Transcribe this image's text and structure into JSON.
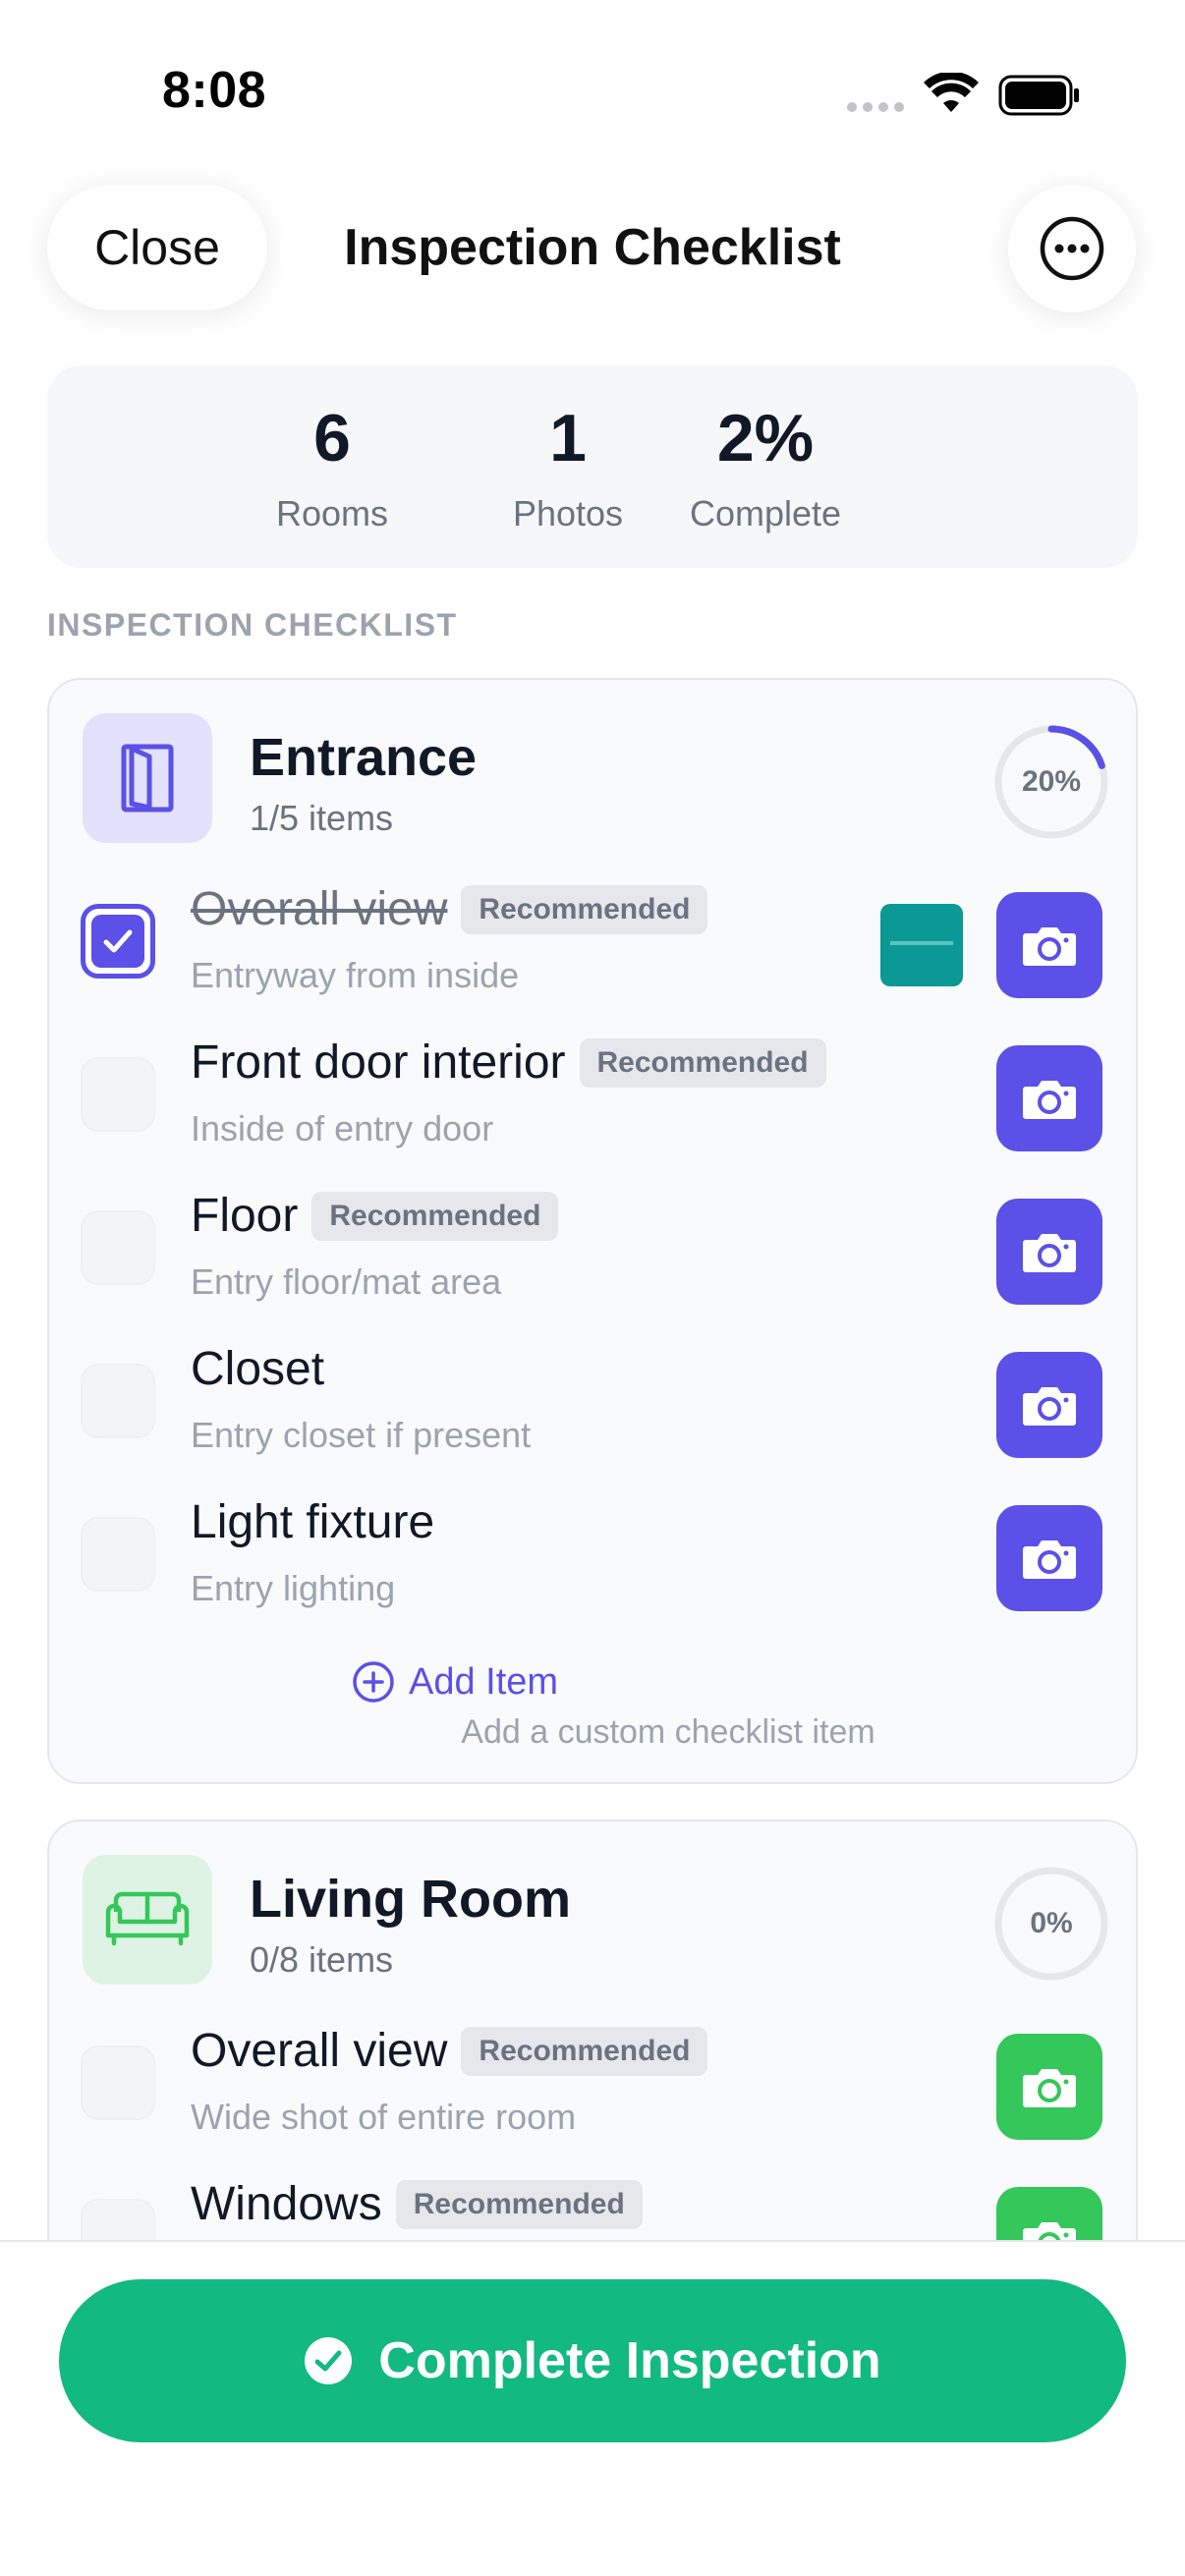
{
  "status_bar": {
    "time": "8:08"
  },
  "header": {
    "close_label": "Close",
    "title": "Inspection Checklist"
  },
  "stats": {
    "rooms": {
      "value": "6",
      "label": "Rooms"
    },
    "photos": {
      "value": "1",
      "label": "Photos"
    },
    "complete": {
      "value": "2%",
      "label": "Complete"
    }
  },
  "section_label": "INSPECTION CHECKLIST",
  "rooms": [
    {
      "name": "Entrance",
      "count": "1/5 items",
      "progress_text": "20%",
      "progress": 0.2,
      "icon": "door-icon",
      "items": [
        {
          "title": "Overall view",
          "badge": "Recommended",
          "subtitle": "Entryway from inside",
          "checked": true,
          "has_photo": true
        },
        {
          "title": "Front door interior",
          "badge": "Recommended",
          "subtitle": "Inside of entry door",
          "checked": false
        },
        {
          "title": "Floor",
          "badge": "Recommended",
          "subtitle": "Entry floor/mat area",
          "checked": false
        },
        {
          "title": "Closet",
          "subtitle": "Entry closet if present",
          "checked": false
        },
        {
          "title": "Light fixture",
          "subtitle": "Entry lighting",
          "checked": false
        }
      ],
      "add_item_label": "Add Item",
      "add_item_subtitle": "Add a custom checklist item"
    },
    {
      "name": "Living Room",
      "count": "0/8 items",
      "progress_text": "0%",
      "progress": 0,
      "icon": "sofa-icon",
      "items": [
        {
          "title": "Overall view",
          "badge": "Recommended",
          "subtitle": "Wide shot of entire room",
          "checked": false
        },
        {
          "title": "Windows",
          "badge": "Recommended",
          "checked": false
        }
      ]
    }
  ],
  "complete_button_label": "Complete Inspection",
  "colors": {
    "accent": "#5b50e8",
    "green": "#34c759",
    "complete": "#12b981"
  }
}
